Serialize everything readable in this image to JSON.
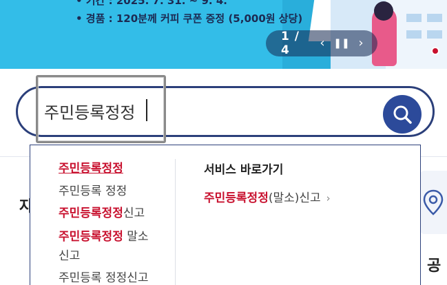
{
  "banner": {
    "line1": "• 기간 : 2025. 7. 31. ~ 9. 4.",
    "line2": "• 경품 : 120분께 커피 쿠폰 증정 (5,000원 상당)",
    "pager": {
      "current": "1",
      "separator": "/",
      "total": "4",
      "prev_icon": "‹",
      "pause_icon": "❚❚",
      "next_icon": "›"
    }
  },
  "search": {
    "value": "주민등록정정",
    "button_icon": "search-icon"
  },
  "autocomplete": {
    "suggestions": [
      {
        "highlight": "주민등록정정",
        "rest": ""
      },
      {
        "highlight": "",
        "rest": "주민등록 정정"
      },
      {
        "highlight": "주민등록정정",
        "rest": "신고"
      },
      {
        "highlight": "주민등록정정",
        "rest": " 말소"
      },
      {
        "highlight": "",
        "rest": "신고"
      },
      {
        "highlight": "",
        "rest": "주민등록 정정신고"
      }
    ],
    "services": {
      "title": "서비스 바로가기",
      "link_highlight": "주민등록정정",
      "link_rest": "(말소)신고",
      "link_chevron": "›"
    }
  },
  "background": {
    "heading_partial": "자",
    "heading2_partial": "공",
    "card_icon": "location-pin-icon"
  },
  "colors": {
    "accent_navy": "#2b3f7a",
    "highlight_red": "#c8102e",
    "banner_blue": "#33bde8"
  }
}
